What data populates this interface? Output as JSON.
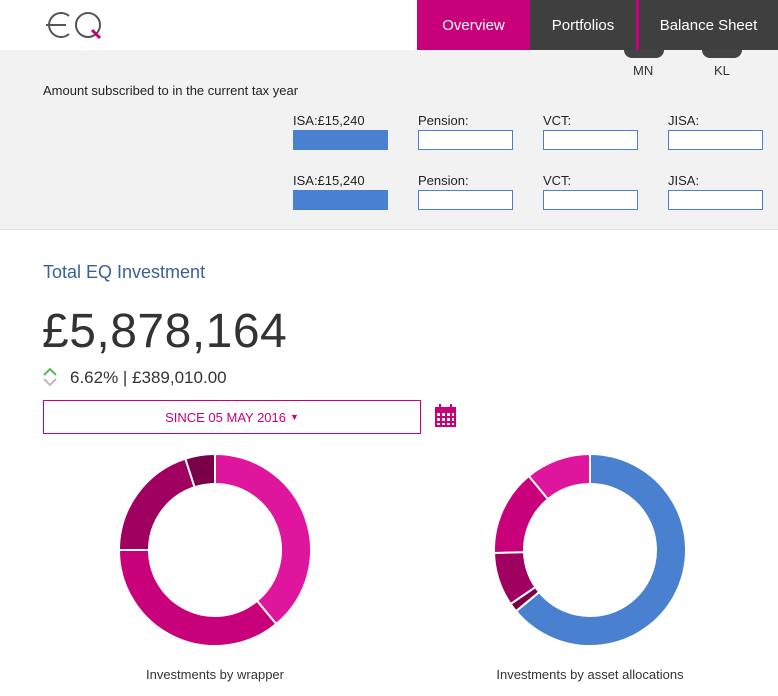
{
  "nav": {
    "overview": "Overview",
    "portfolios": "Portfolios",
    "balance_sheet": "Balance Sheet"
  },
  "clients": [
    {
      "initials": "MN"
    },
    {
      "initials": "KL"
    }
  ],
  "subscriptions": {
    "title": "Amount subscribed to in the current tax year",
    "rows": [
      {
        "isa": "ISA:£15,240",
        "pension": "Pension:",
        "vct": "VCT:",
        "jisa": "JISA:"
      },
      {
        "isa": "ISA:£15,240",
        "pension": "Pension:",
        "vct": "VCT:",
        "jisa": "JISA:"
      }
    ]
  },
  "investment": {
    "title": "Total EQ Investment",
    "amount": "£5,878,164",
    "change": "6.62% | £389,010.00",
    "since_label": "SINCE 05 MAY 2016"
  },
  "charts": {
    "wrapper_label": "Investments by wrapper",
    "asset_label": "Investments by asset allocations"
  },
  "chart_data": [
    {
      "type": "pie",
      "title": "Investments by wrapper",
      "values": [
        39,
        36,
        20,
        5
      ],
      "colors": [
        "#e0159e",
        "#c8007a",
        "#a0005f",
        "#7a0048"
      ]
    },
    {
      "type": "pie",
      "title": "Investments by asset allocations",
      "values": [
        64,
        1.5,
        9,
        14.5,
        11
      ],
      "colors": [
        "#4a80d0",
        "#7a0048",
        "#a0005f",
        "#c8007a",
        "#e0159e"
      ]
    }
  ],
  "colors": {
    "brand": "#c8007a",
    "nav_dark": "#3f3f3f",
    "accent_blue": "#4a80d0",
    "title_blue": "#3c5f96",
    "positive": "#5cb85c"
  },
  "icons": {
    "logo": "eq-logo",
    "change": "up-down-chevron-icon",
    "calendar": "calendar-icon",
    "caret": "caret-down-icon"
  }
}
